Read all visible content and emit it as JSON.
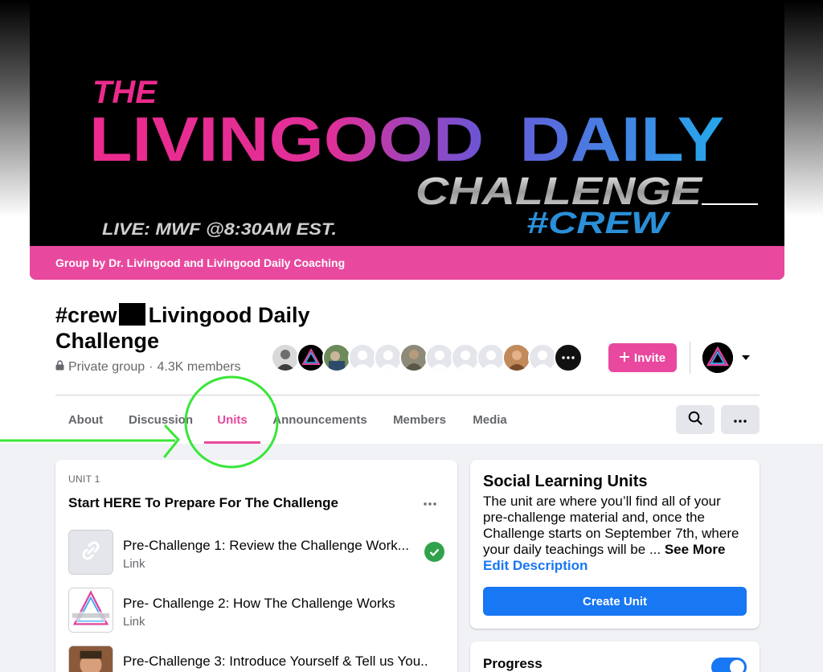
{
  "cover": {
    "line_the": "THE",
    "line_main_a": "LIVINGOOD",
    "line_main_b": "DAILY",
    "line_challenge": "CHALLENGE",
    "line_live": "LIVE: MWF @8:30AM EST.",
    "line_crew": "#CREW",
    "group_by": "Group by Dr. Livingood and Livingood Daily Coaching"
  },
  "group": {
    "title_a": "#crew",
    "title_b": "Livingood Daily Challenge",
    "privacy": "Private group",
    "separator": "·",
    "members": "4.3K members"
  },
  "actions": {
    "invite_label": "Invite",
    "invite_icon": "plus-icon",
    "profile_icon": "chevron-down-icon"
  },
  "tabs": [
    {
      "label": "About"
    },
    {
      "label": "Discussion"
    },
    {
      "label": "Units",
      "active": true
    },
    {
      "label": "Announcements"
    },
    {
      "label": "Members"
    },
    {
      "label": "Media"
    }
  ],
  "unit": {
    "label": "UNIT 1",
    "title": "Start HERE To Prepare For The Challenge",
    "lessons": [
      {
        "title": "Pre-Challenge 1: Review the Challenge Work...",
        "type": "Link",
        "completed": true
      },
      {
        "title": "Pre- Challenge 2: How The Challenge Works",
        "type": "Link",
        "completed": false
      },
      {
        "title": "Pre-Challenge 3: Introduce Yourself & Tell us You...",
        "type": "",
        "completed": false
      }
    ]
  },
  "info": {
    "title": "Social Learning Units",
    "description": "The unit are where you’ll find all of your pre-challenge material and, once the Challenge starts on September 7th, where your daily teachings will be ...",
    "see_more": "See More",
    "edit": "Edit Description",
    "create": "Create Unit"
  },
  "progress": {
    "title": "Progress",
    "enabled": true
  },
  "colors": {
    "brand_pink": "#e8499e",
    "fb_blue": "#1877f2",
    "success_green": "#31a24c",
    "annotation_green": "#39e639"
  }
}
